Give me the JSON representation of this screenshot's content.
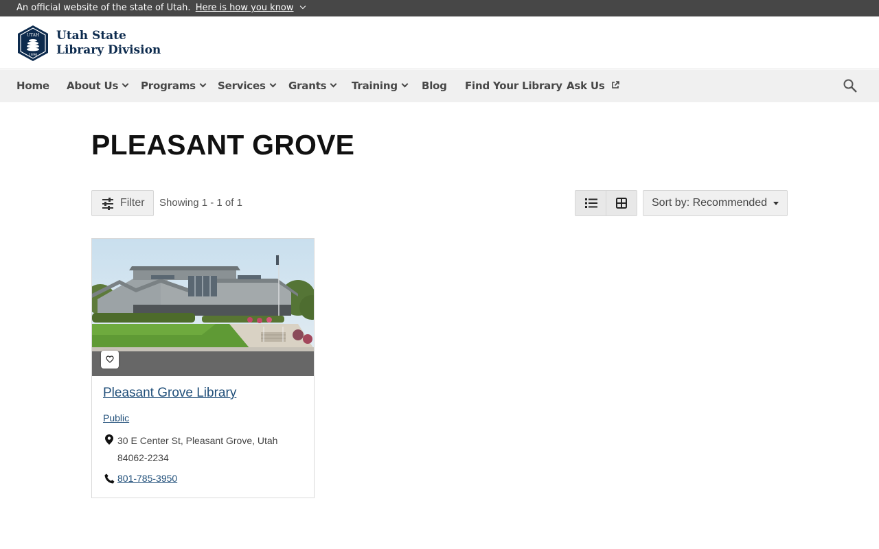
{
  "banner": {
    "text": "An official website of the state of Utah.",
    "link": "Here is how you know"
  },
  "header": {
    "logo_line1": "Utah State",
    "logo_line2": "Library Division",
    "seal_top": "UTAH",
    "seal_bottom": "1896"
  },
  "nav": {
    "items": [
      {
        "label": "Home",
        "dropdown": false
      },
      {
        "label": "About Us",
        "dropdown": true
      },
      {
        "label": "Programs",
        "dropdown": true
      },
      {
        "label": "Services",
        "dropdown": true
      },
      {
        "label": "Grants",
        "dropdown": true
      },
      {
        "label": "Training",
        "dropdown": true
      },
      {
        "label": "Blog",
        "dropdown": false
      },
      {
        "label": "Find Your Library",
        "dropdown": false
      },
      {
        "label": "Ask Us",
        "external": true
      }
    ],
    "search_icon": "search-icon"
  },
  "page": {
    "title": "PLEASANT GROVE"
  },
  "toolbar": {
    "filter_label": "Filter",
    "showing": "Showing 1 - 1 of 1",
    "sort_label": "Sort by: Recommended",
    "list_view_icon": "list-view-icon",
    "grid_view_icon": "grid-view-icon"
  },
  "results": [
    {
      "name": "Pleasant Grove Library",
      "type": "Public",
      "address": "30 E Center St, Pleasant Grove, Utah 84062-2234",
      "phone": "801-785-3950",
      "favorite_icon": "heart-icon"
    }
  ],
  "colors": {
    "banner_bg": "#474747",
    "nav_bg": "#f0f0f0",
    "link": "#1f4e79",
    "brand_navy": "#0d2b4e"
  }
}
